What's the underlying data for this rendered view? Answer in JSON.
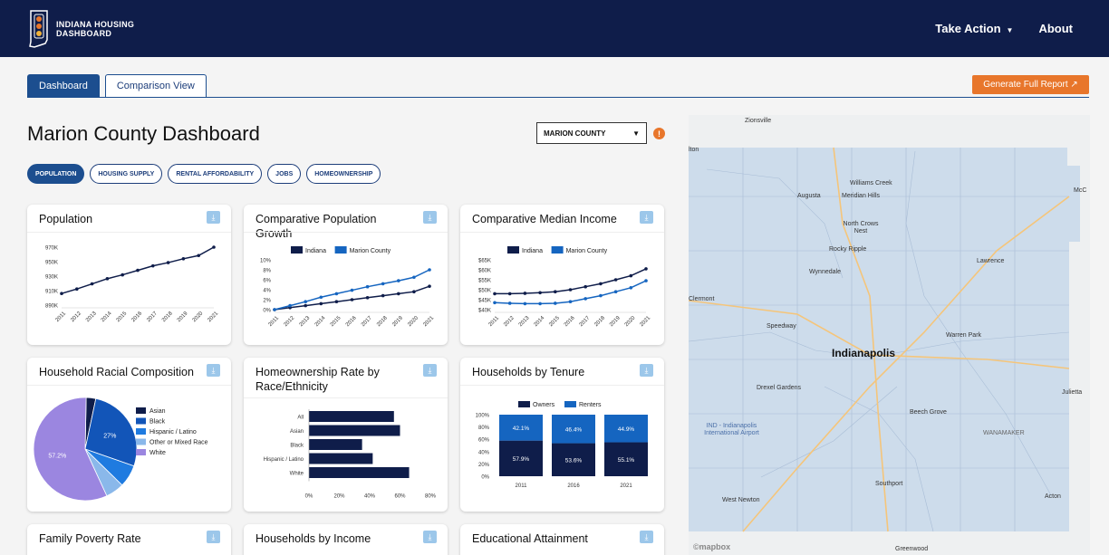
{
  "header": {
    "logo_line1": "INDIANA HOUSING",
    "logo_line2": "DASHBOARD",
    "nav": [
      {
        "label": "Take Action",
        "caret": "▼"
      },
      {
        "label": "About"
      }
    ]
  },
  "tabs": [
    {
      "label": "Dashboard",
      "active": true
    },
    {
      "label": "Comparison View",
      "active": false
    }
  ],
  "generate_button": "Generate Full Report ↗",
  "page_title": "Marion County Dashboard",
  "county_select": {
    "value": "MARION COUNTY"
  },
  "info_icon": "!",
  "filters": [
    {
      "label": "POPULATION",
      "active": true
    },
    {
      "label": "HOUSING SUPPLY",
      "active": false
    },
    {
      "label": "RENTAL AFFORDABILITY",
      "active": false
    },
    {
      "label": "JOBS",
      "active": false
    },
    {
      "label": "HOMEOWNERSHIP",
      "active": false
    }
  ],
  "cards": {
    "population": {
      "title": "Population"
    },
    "comp_growth": {
      "title": "Comparative Population Growth"
    },
    "comp_income": {
      "title": "Comparative Median Income"
    },
    "racial": {
      "title": "Household Racial Composition"
    },
    "homeown_race": {
      "title": "Homeownership Rate by Race/Ethnicity"
    },
    "tenure": {
      "title": "Households by Tenure"
    },
    "poverty": {
      "title": "Family Poverty Rate"
    },
    "income": {
      "title": "Households by Income"
    },
    "education": {
      "title": "Educational Attainment"
    }
  },
  "download_icon": "⤓",
  "colors": {
    "navy": "#0f1d4a",
    "blue": "#1565c0",
    "accent": "#e8762b"
  },
  "chart_data": [
    {
      "type": "line",
      "title": "Population",
      "x": [
        "2011",
        "2012",
        "2013",
        "2014",
        "2015",
        "2016",
        "2017",
        "2018",
        "2019",
        "2020",
        "2021"
      ],
      "yticks": [
        "970K",
        "950K",
        "930K",
        "910K",
        "890K"
      ],
      "ylim": [
        885000,
        975000
      ],
      "series": [
        {
          "values": [
            903000,
            910000,
            918000,
            926000,
            932000,
            939000,
            946000,
            951000,
            957000,
            962000,
            975000
          ]
        }
      ]
    },
    {
      "type": "line",
      "title": "Comparative Population Growth",
      "x": [
        "2011",
        "2012",
        "2013",
        "2014",
        "2015",
        "2016",
        "2017",
        "2018",
        "2019",
        "2020",
        "2021"
      ],
      "yticks": [
        "10%",
        "8%",
        "6%",
        "4%",
        "2%",
        "0%"
      ],
      "ylim": [
        0,
        10
      ],
      "series": [
        {
          "name": "Indiana",
          "values": [
            0,
            0.4,
            0.8,
            1.2,
            1.6,
            2.0,
            2.4,
            2.8,
            3.2,
            3.6,
            4.7
          ]
        },
        {
          "name": "Marion County",
          "values": [
            0,
            0.8,
            1.6,
            2.5,
            3.2,
            3.9,
            4.6,
            5.2,
            5.8,
            6.5,
            8.0
          ]
        }
      ]
    },
    {
      "type": "line",
      "title": "Comparative Median Income",
      "x": [
        "2011",
        "2012",
        "2013",
        "2014",
        "2015",
        "2016",
        "2017",
        "2018",
        "2019",
        "2020",
        "2021"
      ],
      "yticks": [
        "$65K",
        "$60K",
        "$55K",
        "$50K",
        "$45K",
        "$40K"
      ],
      "ylim": [
        40000,
        65000
      ],
      "series": [
        {
          "name": "Indiana",
          "values": [
            48000,
            48000,
            48200,
            48500,
            49000,
            50000,
            51500,
            53000,
            55000,
            57000,
            60500
          ]
        },
        {
          "name": "Marion County",
          "values": [
            43500,
            43200,
            43000,
            43000,
            43200,
            44000,
            45500,
            47000,
            49000,
            51000,
            54500
          ]
        }
      ]
    },
    {
      "type": "pie",
      "title": "Household Racial Composition",
      "series": [
        {
          "name": "Asian",
          "value": 3,
          "color": "#0f1d4a"
        },
        {
          "name": "Black",
          "value": 27,
          "color": "#1255b8",
          "label": "27%"
        },
        {
          "name": "Hispanic / Latino",
          "value": 7,
          "color": "#1f7be0"
        },
        {
          "name": "Other or Mixed Race",
          "value": 5.8,
          "color": "#8ab8ea"
        },
        {
          "name": "White",
          "value": 57.2,
          "color": "#9b86e0",
          "label": "57.2%"
        }
      ]
    },
    {
      "type": "bar",
      "title": "Homeownership Rate by Race/Ethnicity",
      "categories": [
        "All",
        "Asian",
        "Black",
        "Hispanic / Latino",
        "White"
      ],
      "values": [
        56,
        60,
        35,
        42,
        66
      ],
      "xticks": [
        "0%",
        "20%",
        "40%",
        "60%",
        "80%"
      ],
      "xlim": [
        0,
        80
      ]
    },
    {
      "type": "bar",
      "title": "Households by Tenure",
      "categories": [
        "2011",
        "2016",
        "2021"
      ],
      "yticks": [
        "100%",
        "80%",
        "60%",
        "40%",
        "20%",
        "0%"
      ],
      "series": [
        {
          "name": "Owners",
          "values": [
            57.9,
            53.6,
            55.1
          ],
          "labels": [
            "57.9%",
            "53.6%",
            "55.1%"
          ]
        },
        {
          "name": "Renters",
          "values": [
            42.1,
            46.4,
            44.9
          ],
          "labels": [
            "42.1%",
            "46.4%",
            "44.9%"
          ]
        }
      ]
    }
  ],
  "map": {
    "labels": [
      {
        "text": "Zionsville"
      },
      {
        "text": "Williams Creek"
      },
      {
        "text": "Augusta"
      },
      {
        "text": "Meridian Hills"
      },
      {
        "text": "North Crows Nest"
      },
      {
        "text": "Rocky Ripple"
      },
      {
        "text": "Wynnedale"
      },
      {
        "text": "Lawrence"
      },
      {
        "text": "Clermont"
      },
      {
        "text": "Speedway"
      },
      {
        "text": "Warren Park"
      },
      {
        "text": "Indianapolis"
      },
      {
        "text": "Drexel Gardens"
      },
      {
        "text": "Julietta"
      },
      {
        "text": "Beech Grove"
      },
      {
        "text": "IND - Indianapolis International Airport"
      },
      {
        "text": "WANAMAKER"
      },
      {
        "text": "Southport"
      },
      {
        "text": "West Newton"
      },
      {
        "text": "Acton"
      },
      {
        "text": "Greenwood"
      },
      {
        "text": "McC"
      },
      {
        "text": "lton"
      }
    ],
    "attribution": "©mapbox"
  }
}
